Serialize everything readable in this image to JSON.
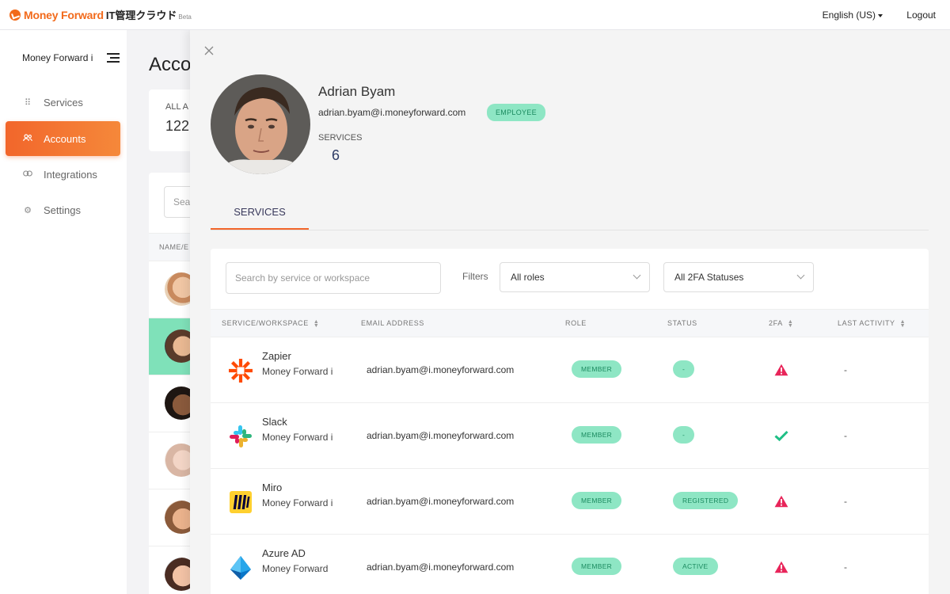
{
  "header": {
    "brand": "Money Forward",
    "product": "IT管理クラウド",
    "beta": "Beta",
    "language": "English (US)",
    "logout": "Logout"
  },
  "sidebar": {
    "org_name": "Money Forward i",
    "items": [
      {
        "label": "Services",
        "icon": "grid-icon"
      },
      {
        "label": "Accounts",
        "icon": "users-icon",
        "active": true
      },
      {
        "label": "Integrations",
        "icon": "link-icon"
      },
      {
        "label": "Settings",
        "icon": "gear-icon"
      }
    ]
  },
  "main": {
    "title": "Acco",
    "stat_label": "ALL A",
    "stat_value": "122",
    "search_placeholder": "Sea",
    "column_header": "NAME/E"
  },
  "drawer": {
    "name": "Adrian Byam",
    "email": "adrian.byam@i.moneyforward.com",
    "badge": "EMPLOYEE",
    "services_label": "SERVICES",
    "services_count": "6",
    "tab": "SERVICES",
    "search_placeholder": "Search by service or workspace",
    "filters_label": "Filters",
    "role_filter": "All roles",
    "twofa_filter": "All 2FA Statuses",
    "columns": {
      "service": "SERVICE/WORKSPACE",
      "email": "EMAIL ADDRESS",
      "role": "ROLE",
      "status": "STATUS",
      "twofa": "2FA",
      "last": "LAST ACTIVITY"
    },
    "rows": [
      {
        "service": "Zapier",
        "workspace": "Money Forward i",
        "email": "adrian.byam@i.moneyforward.com",
        "role": "MEMBER",
        "status": "-",
        "twofa": "warning",
        "last": "-"
      },
      {
        "service": "Slack",
        "workspace": "Money Forward i",
        "email": "adrian.byam@i.moneyforward.com",
        "role": "MEMBER",
        "status": "-",
        "twofa": "check",
        "last": "-"
      },
      {
        "service": "Miro",
        "workspace": "Money Forward i",
        "email": "adrian.byam@i.moneyforward.com",
        "role": "MEMBER",
        "status": "REGISTERED",
        "twofa": "warning",
        "last": "-"
      },
      {
        "service": "Azure AD",
        "workspace": "Money Forward",
        "email": "adrian.byam@i.moneyforward.com",
        "role": "MEMBER",
        "status": "ACTIVE",
        "twofa": "warning",
        "last": "-"
      }
    ]
  },
  "colors": {
    "accent": "#f2662b",
    "badge_bg": "#8ee6c4",
    "badge_text": "#1b8a5f",
    "warning": "#e8255a",
    "check": "#1fbf86"
  }
}
